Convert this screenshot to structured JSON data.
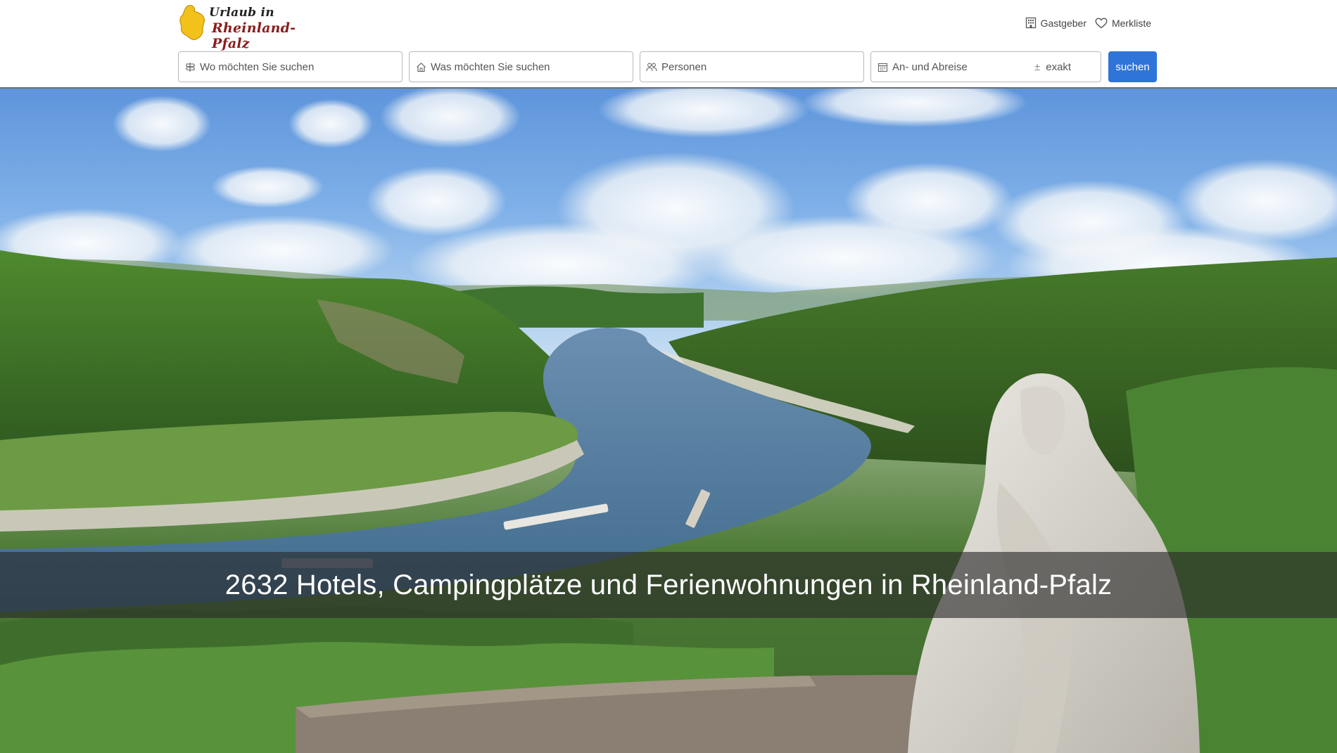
{
  "brand": {
    "logo_line1": "Urlaub in",
    "logo_line2": "Rheinland-Pfalz",
    "logo_color": "#f2c21b"
  },
  "top_nav": {
    "host": {
      "label": "Gastgeber",
      "icon": "building-icon"
    },
    "wishlist": {
      "label": "Merkliste",
      "icon": "heart-icon"
    }
  },
  "search": {
    "where": {
      "placeholder": "Wo möchten Sie suchen",
      "value": "",
      "icon": "signpost-icon"
    },
    "what": {
      "placeholder": "Was möchten Sie suchen",
      "value": "",
      "icon": "house-icon"
    },
    "persons": {
      "placeholder": "Personen",
      "value": "",
      "icon": "people-icon"
    },
    "dates": {
      "placeholder": "An- und Abreise",
      "value": "",
      "icon": "calendar-icon",
      "flex_label": "exakt",
      "flex_icon": "plus-minus-icon"
    },
    "submit_label": "suchen",
    "accent_color": "#2f74d9"
  },
  "hero": {
    "headline": "2632 Hotels, Campingplätze und Ferienwohnungen in Rheinland-Pfalz"
  }
}
